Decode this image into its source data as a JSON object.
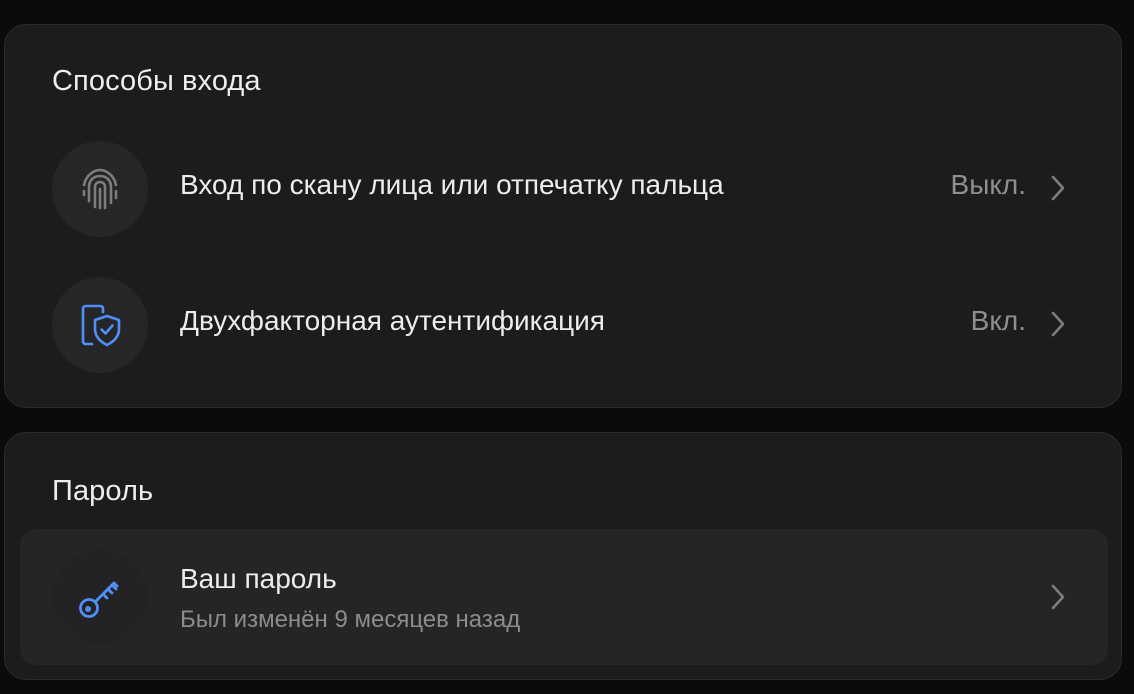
{
  "login_methods": {
    "title": "Способы входа",
    "items": [
      {
        "label": "Вход по скану лица или отпечатку пальца",
        "status": "Выкл.",
        "icon": "fingerprint-icon"
      },
      {
        "label": "Двухфакторная аутентификация",
        "status": "Вкл.",
        "icon": "shield-check-icon"
      }
    ]
  },
  "password": {
    "title": "Пароль",
    "item": {
      "label": "Ваш пароль",
      "subtitle": "Был изменён 9 месяцев назад",
      "icon": "key-icon"
    }
  },
  "colors": {
    "accent": "#4f8ff7",
    "background": "#0b0b0b",
    "card": "#1c1c1d",
    "muted_text": "#8f8f92"
  }
}
